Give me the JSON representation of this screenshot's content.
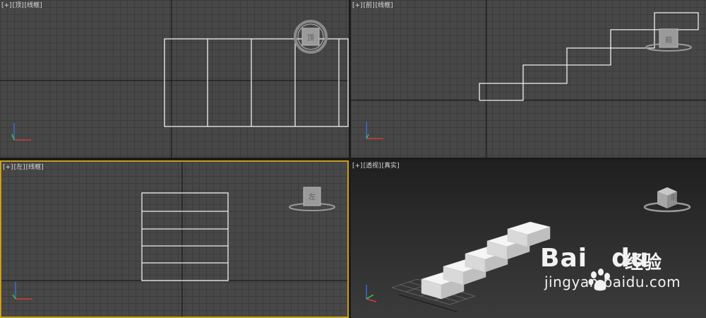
{
  "viewports": {
    "top": {
      "bracket": "[+]",
      "view": "[顶]",
      "mode": "[线框]",
      "cube_face": "顶"
    },
    "front": {
      "bracket": "[+]",
      "view": "[前]",
      "mode": "[线框]",
      "cube_face": "前"
    },
    "left": {
      "bracket": "[+]",
      "view": "[左]",
      "mode": "[线框]",
      "cube_face": "左"
    },
    "persp": {
      "bracket": "[+]",
      "view": "[透视]",
      "mode": "[真实]",
      "cube_face": "前"
    }
  },
  "watermark": {
    "brand_a": "Bai",
    "brand_b": "du",
    "brand_cn": "经验",
    "url": "jingyan.baidu.com"
  },
  "colors": {
    "active_border": "#c8a020",
    "axis_x": "#d23c3c",
    "axis_y": "#3cc83c",
    "axis_z": "#3c6ed2"
  }
}
